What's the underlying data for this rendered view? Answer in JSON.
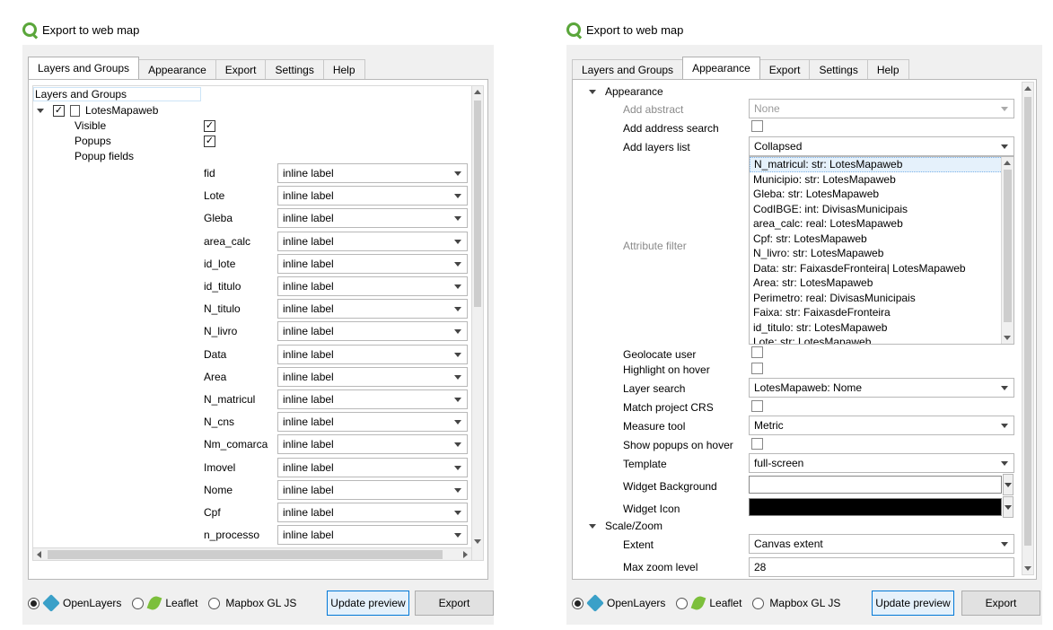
{
  "left_window": {
    "title": "Export to web map",
    "tabs": [
      "Layers and Groups",
      "Appearance",
      "Export",
      "Settings",
      "Help"
    ],
    "active_tab": "Layers and Groups",
    "tree": {
      "root_label": "Layers and Groups",
      "layer_name": "LotesMapaweb",
      "visible_label": "Visible",
      "popups_label": "Popups",
      "popup_fields_label": "Popup fields",
      "check_mark": "✓",
      "fields": [
        {
          "name": "fid",
          "value": "inline label"
        },
        {
          "name": "Lote",
          "value": "inline label"
        },
        {
          "name": "Gleba",
          "value": "inline label"
        },
        {
          "name": "area_calc",
          "value": "inline label"
        },
        {
          "name": "id_lote",
          "value": "inline label"
        },
        {
          "name": "id_titulo",
          "value": "inline label"
        },
        {
          "name": "N_titulo",
          "value": "inline label"
        },
        {
          "name": "N_livro",
          "value": "inline label"
        },
        {
          "name": "Data",
          "value": "inline label"
        },
        {
          "name": "Area",
          "value": "inline label"
        },
        {
          "name": "N_matricul",
          "value": "inline label"
        },
        {
          "name": "N_cns",
          "value": "inline label"
        },
        {
          "name": "Nm_comarca",
          "value": "inline label"
        },
        {
          "name": "Imovel",
          "value": "inline label"
        },
        {
          "name": "Nome",
          "value": "inline label"
        },
        {
          "name": "Cpf",
          "value": "inline label"
        },
        {
          "name": "n_processo",
          "value": "inline label"
        }
      ]
    }
  },
  "right_window": {
    "title": "Export to web map",
    "tabs": [
      "Layers and Groups",
      "Appearance",
      "Export",
      "Settings",
      "Help"
    ],
    "active_tab": "Appearance",
    "appearance_section": "Appearance",
    "add_abstract": {
      "label": "Add abstract",
      "value": "None"
    },
    "add_address_search": {
      "label": "Add address search"
    },
    "add_layers_list": {
      "label": "Add layers list",
      "value": "Collapsed"
    },
    "attribute_filter": {
      "label": "Attribute filter",
      "items": [
        "N_matricul: str: LotesMapaweb",
        "Municipio: str: LotesMapaweb",
        "Gleba: str: LotesMapaweb",
        "CodIBGE: int: DivisasMunicipais",
        "area_calc: real: LotesMapaweb",
        "Cpf: str: LotesMapaweb",
        "N_livro: str: LotesMapaweb",
        "Data: str: FaixasdeFronteira| LotesMapaweb",
        "Area: str: LotesMapaweb",
        "Perimetro: real: DivisasMunicipais",
        "Faixa: str: FaixasdeFronteira",
        "id_titulo: str: LotesMapaweb",
        "Lote: str: LotesMapaweb"
      ]
    },
    "geolocate_user": {
      "label": "Geolocate user"
    },
    "highlight_on_hover": {
      "label": "Highlight on hover"
    },
    "layer_search": {
      "label": "Layer search",
      "value": "LotesMapaweb: Nome"
    },
    "match_project_crs": {
      "label": "Match project CRS"
    },
    "measure_tool": {
      "label": "Measure tool",
      "value": "Metric"
    },
    "show_popups_on_hover": {
      "label": "Show popups on hover"
    },
    "template": {
      "label": "Template",
      "value": "full-screen"
    },
    "widget_background": {
      "label": "Widget Background",
      "color": "#ffffff"
    },
    "widget_icon": {
      "label": "Widget Icon",
      "color": "#000000"
    },
    "scale_zoom_section": "Scale/Zoom",
    "extent": {
      "label": "Extent",
      "value": "Canvas extent"
    },
    "cut_row": {
      "label": "Max zoom level",
      "value": "28"
    }
  },
  "bottom_bar": {
    "openlayers": "OpenLayers",
    "leaflet": "Leaflet",
    "mapbox": "Mapbox GL JS",
    "selected": "OpenLayers",
    "update_preview": "Update preview",
    "export": "Export"
  }
}
